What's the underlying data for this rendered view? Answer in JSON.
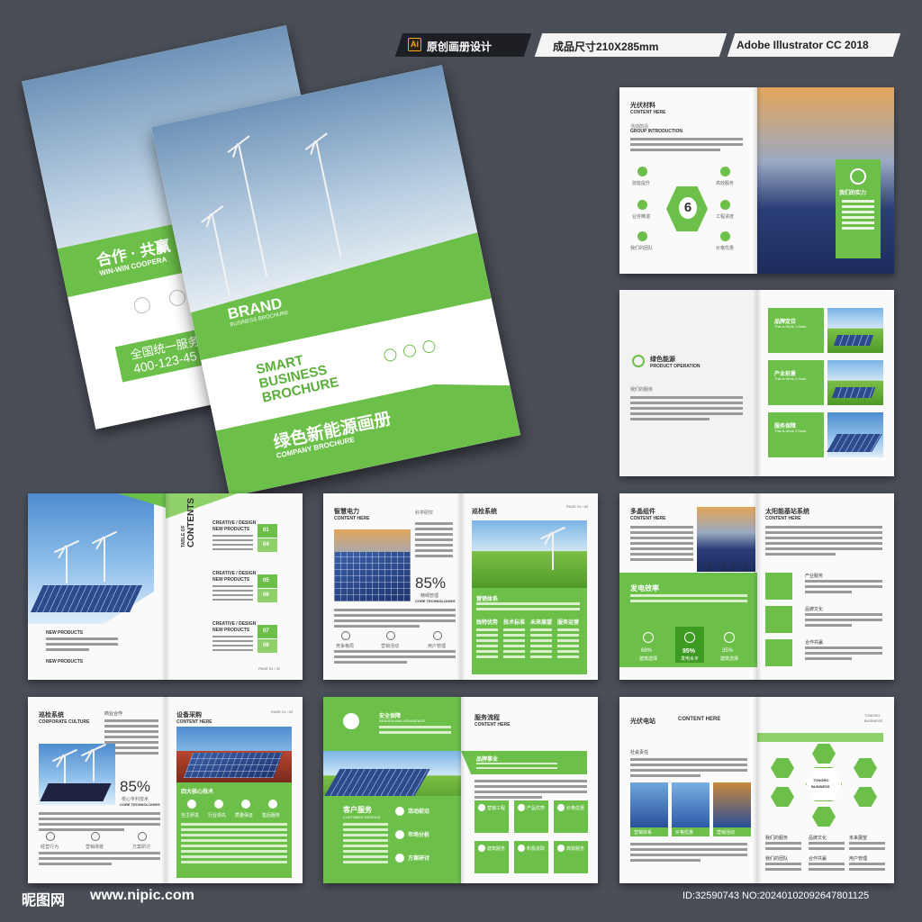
{
  "header": {
    "ai_badge": "Ai",
    "tag1": "原创画册设计",
    "tag2": "成品尺寸210X285mm",
    "tag3": "Adobe Illustrator CC 2018"
  },
  "cover_back": {
    "slogan": "合作 · 共赢",
    "sub": "WIN-WIN COOPERA",
    "hotline": "全国统一服务热",
    "phone": "400-123-45"
  },
  "cover_front": {
    "brand": "BRAND",
    "brand_sub": "BUSINESS BROCHURE",
    "smart1": "SMART",
    "smart2": "BUSINESS",
    "smart3": "BROCHURE",
    "title_cn": "绿色新能源画册",
    "title_en": "COMPANY BROCHURE"
  },
  "s1": {
    "title": "光伏材料",
    "content": "CONTENT HERE",
    "intro_cn": "活动前沿",
    "intro_en": "GROUP INTRODUCTION",
    "badge": "6",
    "items": [
      "技能提升",
      "业务精湛",
      "我们的团队",
      "高效服务",
      "工程进度",
      "价格优惠"
    ],
    "strength": "我们的实力"
  },
  "s2": {
    "title_cn": "绿色能源",
    "title_en": "PRODUCT OPERATION",
    "service": "我们的服务",
    "blocks": [
      {
        "cn": "品牌定位",
        "en": "This is Work 1 Data"
      },
      {
        "cn": "产业前景",
        "en": "This is Work 2 Data"
      },
      {
        "cn": "服务保障",
        "en": "This is Work 3 Data"
      }
    ]
  },
  "s3": {
    "toc1": "TABLE OF",
    "toc2": "CONTENTS",
    "sections": [
      {
        "h": "CREATIVE / DESIGN",
        "p": "NEW PRODUCTS",
        "n1": "01",
        "n2": "04"
      },
      {
        "h": "CREATIVE / DESIGN",
        "p": "NEW PRODUCTS",
        "n1": "05",
        "n2": "06"
      },
      {
        "h": "CREATIVE / DESIGN",
        "p": "NEW PRODUCTS",
        "n1": "07",
        "n2": "08"
      }
    ],
    "left_cap1": "NEW PRODUCTS",
    "left_cap2": "NEW PRODUCTS",
    "page": "PAGE 01 / 02"
  },
  "s4": {
    "title": "智慧电力",
    "content": "CONTENT HERE",
    "side": "科学研究",
    "percent": "85%",
    "pct_cn": "精细管理",
    "pct_en": "CORE TECHNOLOGIES",
    "icons": [
      "竞争格局",
      "营销活动",
      "用户管理"
    ],
    "r_title": "巡检系统",
    "r_page": "PAGE 01 / 02",
    "r_label": "营销体系",
    "tabs": [
      "独特优势",
      "技术标准",
      "未来展望",
      "服务运营"
    ]
  },
  "s5": {
    "title": "多晶组件",
    "content": "CONTENT HERE",
    "band": "发电效率",
    "stats": [
      {
        "v": "68%",
        "l": "建筑选择"
      },
      {
        "v": "95%",
        "l": "发电水平"
      },
      {
        "v": "35%",
        "l": "建筑选择"
      }
    ],
    "r_title": "太阳能基站系统",
    "r_content": "CONTENT HERE",
    "r_items": [
      "产业服务",
      "品牌文化",
      "合作共赢"
    ]
  },
  "s6": {
    "title_cn": "巡检系统",
    "title_en": "CORPORATE CULTURE",
    "side": "商业合作",
    "percent": "85%",
    "pct_cn": "核心专利技术",
    "pct_en": "CORE TECHNOLOGIES",
    "icons": [
      "经营行为",
      "营销场景",
      "方案研讨"
    ],
    "r_title": "设备采购",
    "r_content": "CONTENT HERE",
    "r_page": "PAGE 01 / 02",
    "r_band": "四大核心技术",
    "r_icons": [
      "自主研发",
      "行业领先",
      "质量保证",
      "售后服务"
    ]
  },
  "s7": {
    "safe_cn": "安全保障",
    "safe_en": "REASON AND ADVANTAGE",
    "cs_cn": "客户服务",
    "cs_en": "CUSTOMER SERVICE",
    "cs_items": [
      "活动前沿",
      "市场分析",
      "方案研讨"
    ],
    "r_title": "服务流程",
    "r_content": "CONTENT HERE",
    "r_band": "品牌事业",
    "flow": [
      "营销工程",
      "产品优势",
      "价格优惠",
      "建筑服务",
      "积极进取",
      "高效服务"
    ]
  },
  "s8": {
    "title": "光伏电站",
    "content": "CONTENT HERE",
    "brand1": "TONGRO",
    "brand2": "BUSINESS",
    "sub": "社会责任",
    "caps": [
      "营销体系",
      "价格优惠",
      "营销活动"
    ],
    "center1": "TONGRO",
    "center2": "BUSINESS",
    "r_items": [
      "我们的服务",
      "品牌文化",
      "未来展望",
      "我们的团队",
      "合作共赢",
      "用户管理"
    ]
  },
  "footer": {
    "logo": "昵图网",
    "url": "www.nipic.com",
    "id": "ID:32590743 NO:20240102092647801125"
  }
}
